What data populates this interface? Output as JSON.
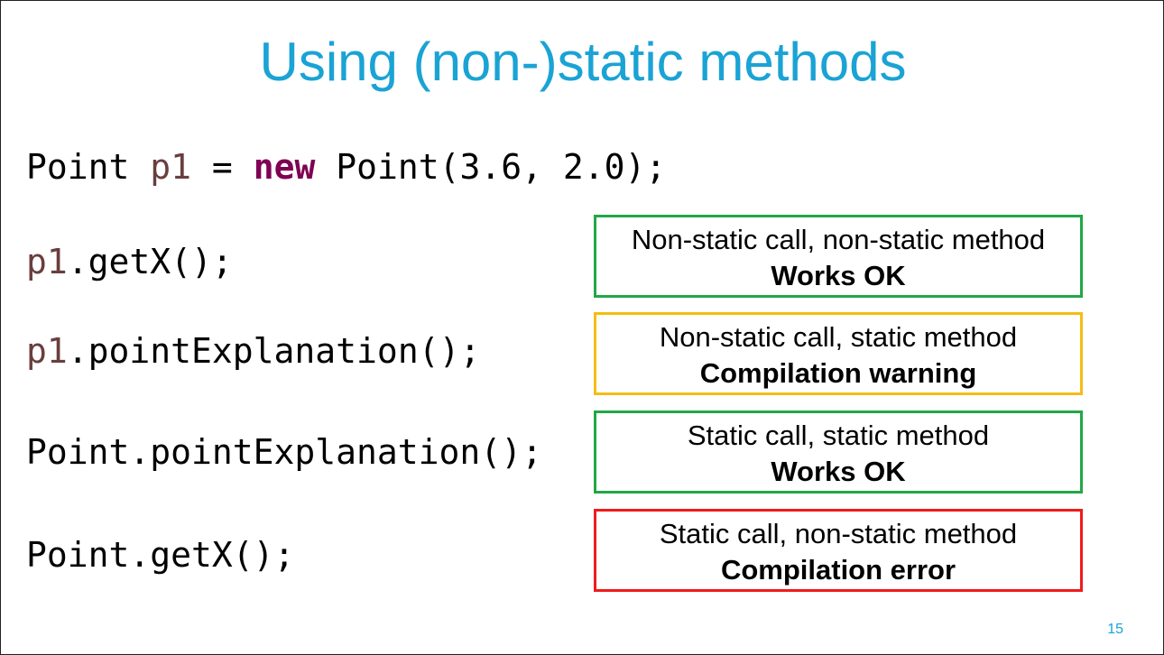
{
  "slide": {
    "title": "Using (non-)static methods",
    "page_number": "15"
  },
  "code": {
    "line1": {
      "type": "Point",
      "var": "p1",
      "equals": " = ",
      "keyword": "new",
      "rest": " Point(3.6, 2.0);"
    },
    "line2": {
      "var": "p1",
      "rest": ".getX();"
    },
    "line3": {
      "var": "p1",
      "rest": ".pointExplanation();"
    },
    "line4": {
      "text": "Point.pointExplanation();"
    },
    "line5": {
      "text": "Point.getX();"
    }
  },
  "boxes": [
    {
      "line1": "Non-static call, non-static method",
      "line2": "Works OK",
      "color": "#22a745"
    },
    {
      "line1": "Non-static call, static method",
      "line2": "Compilation warning",
      "color": "#f5bd12"
    },
    {
      "line1": "Static call, static method",
      "line2": "Works OK",
      "color": "#22a745"
    },
    {
      "line1": "Static call, non-static method",
      "line2": "Compilation error",
      "color": "#f01b1b"
    }
  ]
}
